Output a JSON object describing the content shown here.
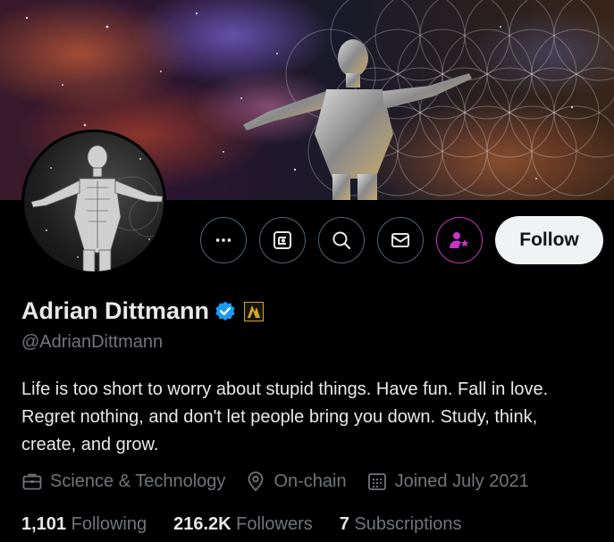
{
  "profile": {
    "name": "Adrian Dittmann",
    "handle": "@AdrianDittmann",
    "bio": "Life is too short to worry about stupid things. Have fun. Fall in love. Regret nothing, and don't let people bring you down. Study, think, create, and grow.",
    "category": "Science & Technology",
    "location": "On-chain",
    "joined": "Joined July 2021"
  },
  "actions": {
    "follow_label": "Follow",
    "icons": [
      "more-icon",
      "grok-icon",
      "search-icon",
      "message-icon",
      "subscribe-icon"
    ]
  },
  "stats": {
    "following_count": "1,101",
    "following_label": "Following",
    "followers_count": "216.2K",
    "followers_label": "Followers",
    "subscriptions_count": "7",
    "subscriptions_label": "Subscriptions"
  },
  "colors": {
    "background": "#000000",
    "text_primary": "#e7e9ea",
    "text_secondary": "#71767b",
    "verified_blue": "#1d9bf0",
    "subscribe_pink": "#c936c6",
    "follow_bg": "#eff3f4"
  }
}
